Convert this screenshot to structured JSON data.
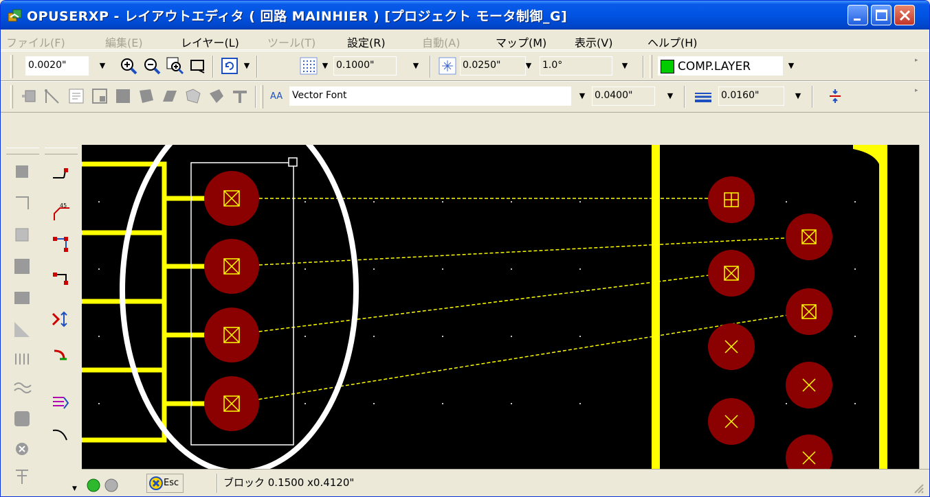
{
  "window": {
    "title": "OPUSERXP - レイアウトエディタ ( 回路 MAINHIER ) [プロジェクト モータ制御_G]"
  },
  "menu": [
    {
      "label": "ファイル(F)",
      "enabled": false
    },
    {
      "label": "編集(E)",
      "enabled": false
    },
    {
      "label": "レイヤー(L)",
      "enabled": true
    },
    {
      "label": "ツール(T)",
      "enabled": false
    },
    {
      "label": "設定(R)",
      "enabled": true
    },
    {
      "label": "自動(A)",
      "enabled": false
    },
    {
      "label": "マップ(M)",
      "enabled": true
    },
    {
      "label": "表示(V)",
      "enabled": true
    },
    {
      "label": "ヘルプ(H)",
      "enabled": true
    }
  ],
  "toolbar1": {
    "zoom_value": "0.0020\"",
    "grid_value": "0.1000\"",
    "snap_value": "0.0250\"",
    "angle_value": "1.0°",
    "layer_name": "COMP.LAYER",
    "layer_color": "#00cc00"
  },
  "toolbar2": {
    "font_icon_label": "AA",
    "font_name": "Vector Font",
    "text_size": "0.0400\"",
    "line_width": "0.0160\""
  },
  "status": {
    "esc_label": "Esc",
    "info": "ブロック 0.1500 x0.4120\""
  },
  "colors": {
    "trace": "#ffff00",
    "pad": "#8b0000",
    "ratsnest": "#ffff00",
    "canvas": "#000000",
    "annotation_ellipse": "#ffffff"
  }
}
